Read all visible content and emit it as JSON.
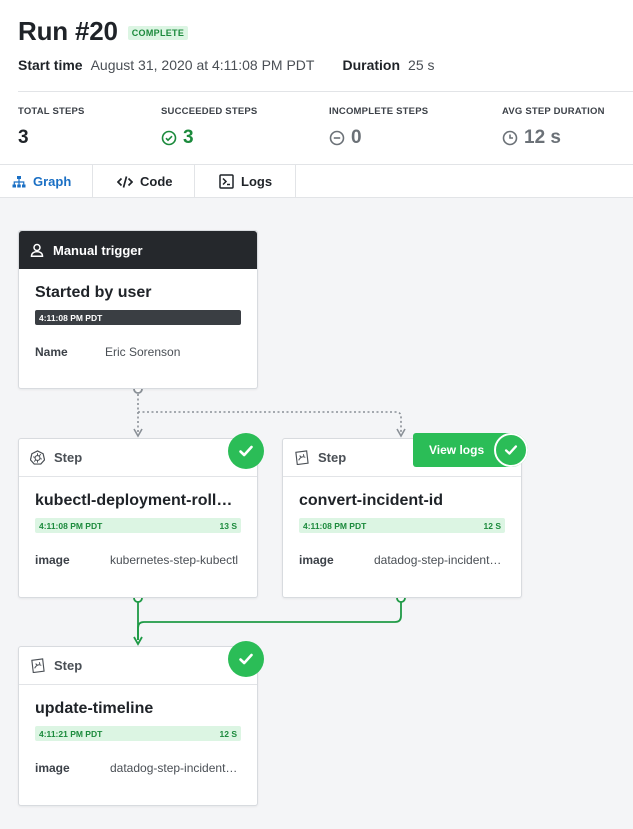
{
  "run": {
    "title": "Run #20",
    "status": "COMPLETE",
    "start_time_label": "Start time",
    "start_time": "August 31, 2020 at 4:11:08 PM PDT",
    "duration_label": "Duration",
    "duration": "25 s"
  },
  "stats": [
    {
      "label": "TOTAL STEPS",
      "value": "3"
    },
    {
      "label": "SUCCEEDED STEPS",
      "value": "3"
    },
    {
      "label": "INCOMPLETE STEPS",
      "value": "0"
    },
    {
      "label": "AVG STEP DURATION",
      "value": "12 s"
    }
  ],
  "tabs": [
    {
      "label": "Graph",
      "active": true
    },
    {
      "label": "Code",
      "active": false
    },
    {
      "label": "Logs",
      "active": false
    }
  ],
  "trigger": {
    "header": "Manual trigger",
    "title": "Started by user",
    "time": "4:11:08 PM PDT",
    "field_key": "Name",
    "field_value": "Eric Sorenson"
  },
  "steps": [
    {
      "header": "Step",
      "title": "kubectl-deployment-rollba...",
      "time": "4:11:08 PM PDT",
      "duration": "13 S",
      "field_key": "image",
      "field_value": "kubernetes-step-kubectl"
    },
    {
      "header": "Step",
      "title": "convert-incident-id",
      "time": "4:11:08 PM PDT",
      "duration": "12 S",
      "field_key": "image",
      "field_value": "datadog-step-incident-ex..."
    },
    {
      "header": "Step",
      "title": "update-timeline",
      "time": "4:11:21 PM PDT",
      "duration": "12 S",
      "field_key": "image",
      "field_value": "datadog-step-incident-ti..."
    }
  ],
  "view_logs_label": "View logs",
  "colors": {
    "success": "#2bbd57",
    "accent": "#1a6fc4",
    "dark": "#25282c"
  }
}
